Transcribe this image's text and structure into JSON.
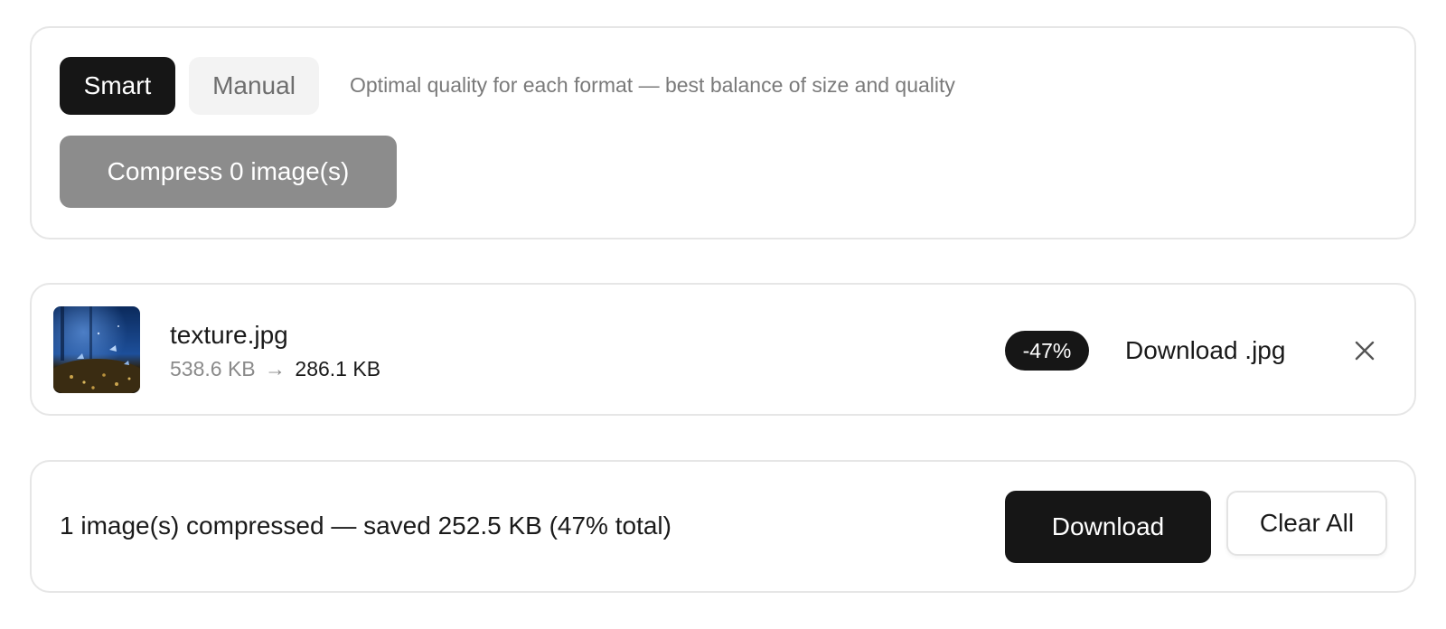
{
  "settings": {
    "modes": [
      {
        "label": "Smart",
        "active": true
      },
      {
        "label": "Manual",
        "active": false
      }
    ],
    "description": "Optimal quality for each format — best balance of size and quality",
    "compress_label": "Compress 0 image(s)"
  },
  "files": [
    {
      "name": "texture.jpg",
      "original_size": "538.6 KB",
      "arrow": "→",
      "compressed_size": "286.1 KB",
      "reduction": "-47%",
      "download_label": "Download .jpg",
      "thumbnail_icon": "image-thumbnail",
      "remove_icon": "close-icon"
    }
  ],
  "summary": {
    "text": "1 image(s) compressed — saved 252.5 KB (47% total)",
    "download_label": "Download",
    "clear_label": "Clear All"
  },
  "colors": {
    "primary": "#161616",
    "disabled": "#8c8c8c",
    "muted_text": "#7a7a7a",
    "border": "#e6e6e6"
  }
}
